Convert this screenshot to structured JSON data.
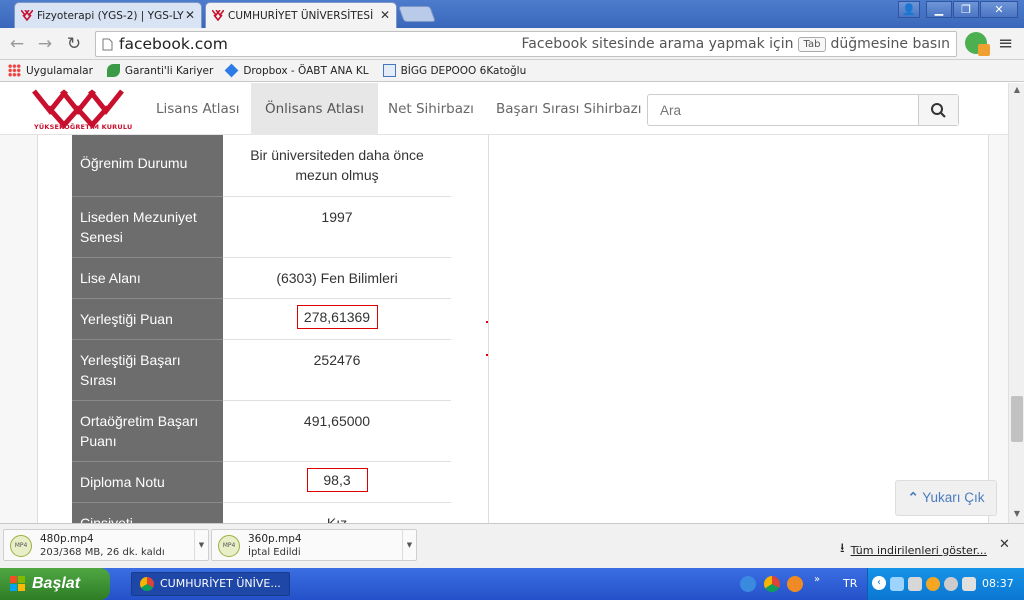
{
  "browser": {
    "tabs": [
      {
        "title": "Fizyoterapi (YGS-2) | YGS-LY"
      },
      {
        "title": "CUMHURİYET ÜNİVERSİTESİ"
      }
    ],
    "url": "facebook.com",
    "omnibox_hint_before": "Facebook sitesinde arama yapmak için",
    "omnibox_hint_key": "Tab",
    "omnibox_hint_after": "düğmesine basın",
    "bookmarks": [
      {
        "label": "Uygulamalar",
        "icon": "apps-grid-icon"
      },
      {
        "label": "Garanti'li Kariyer",
        "icon": "clover-icon"
      },
      {
        "label": "Dropbox - ÖABT ANA KL",
        "icon": "dropbox-icon"
      },
      {
        "label": "BİGG DEPOOO 6Katoğlu",
        "icon": "bookmark-page-icon"
      }
    ]
  },
  "site": {
    "logo_text": "YÜKSEKÖĞRETİM KURULU",
    "nav": [
      "Lisans Atlası",
      "Önlisans Atlası",
      "Net Sihirbazı",
      "Başarı Sırası Sihirbazı"
    ],
    "active_nav": "Önlisans Atlası",
    "search_placeholder": "Ara",
    "brand_color": "#c8102e"
  },
  "table": {
    "rows": [
      {
        "label": "Öğrenim Durumu",
        "value": "Bir üniversiteden daha önce mezun olmuş"
      },
      {
        "label": "Liseden Mezuniyet Senesi",
        "value": "1997"
      },
      {
        "label": "Lise Alanı",
        "value": "(6303) Fen Bilimleri"
      },
      {
        "label": "Yerleştiği Puan",
        "value": "278,61369"
      },
      {
        "label": "Yerleştiği Başarı Sırası",
        "value": "252476"
      },
      {
        "label": "Ortaöğretim Başarı Puanı",
        "value": "491,65000"
      },
      {
        "label": "Diploma Notu",
        "value": "98,3"
      },
      {
        "label": "Cinsiyeti",
        "value": "Kız"
      }
    ]
  },
  "scroll_top_label": "Yukarı Çık",
  "downloads": {
    "items": [
      {
        "name": "480p.mp4",
        "status": "203/368 MB, 26 dk. kaldı"
      },
      {
        "name": "360p.mp4",
        "status": "İptal Edildi"
      }
    ],
    "show_all": "Tüm indirilenleri göster..."
  },
  "taskbar": {
    "start": "Başlat",
    "window": "CUMHURİYET ÜNİVE...",
    "lang": "TR",
    "time": "08:37"
  }
}
